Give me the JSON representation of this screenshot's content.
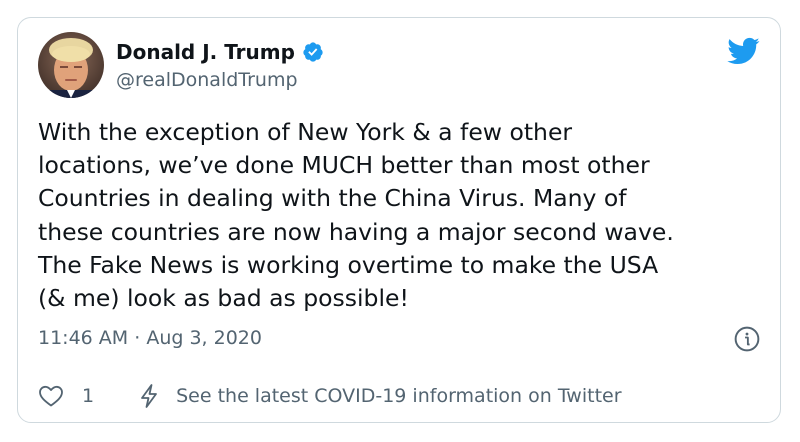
{
  "tweet": {
    "author": {
      "display_name": "Donald J. Trump",
      "handle": "@realDonaldTrump",
      "verified": true,
      "avatar_icon": "avatar-photo"
    },
    "text": "With the exception of New York & a few other\nlocations, we’ve done MUCH better than most other\nCountries in dealing with the China Virus. Many of\nthese countries are now having a major second wave.\nThe Fake News is working overtime to make the USA\n(& me) look as bad as possible!",
    "time": "11:46 AM",
    "separator": "·",
    "date": "Aug 3, 2020",
    "likes": "1",
    "covid_notice": "See the latest COVID-19 information on Twitter"
  },
  "icons": {
    "brand": "twitter-bird-icon",
    "verified": "verified-badge-icon",
    "info": "info-icon",
    "like": "heart-icon",
    "notice": "lightning-bolt-icon"
  },
  "colors": {
    "brand_blue": "#1d9bf0",
    "text_primary": "#0f1419",
    "text_secondary": "#536471",
    "border": "#cfd9de"
  }
}
